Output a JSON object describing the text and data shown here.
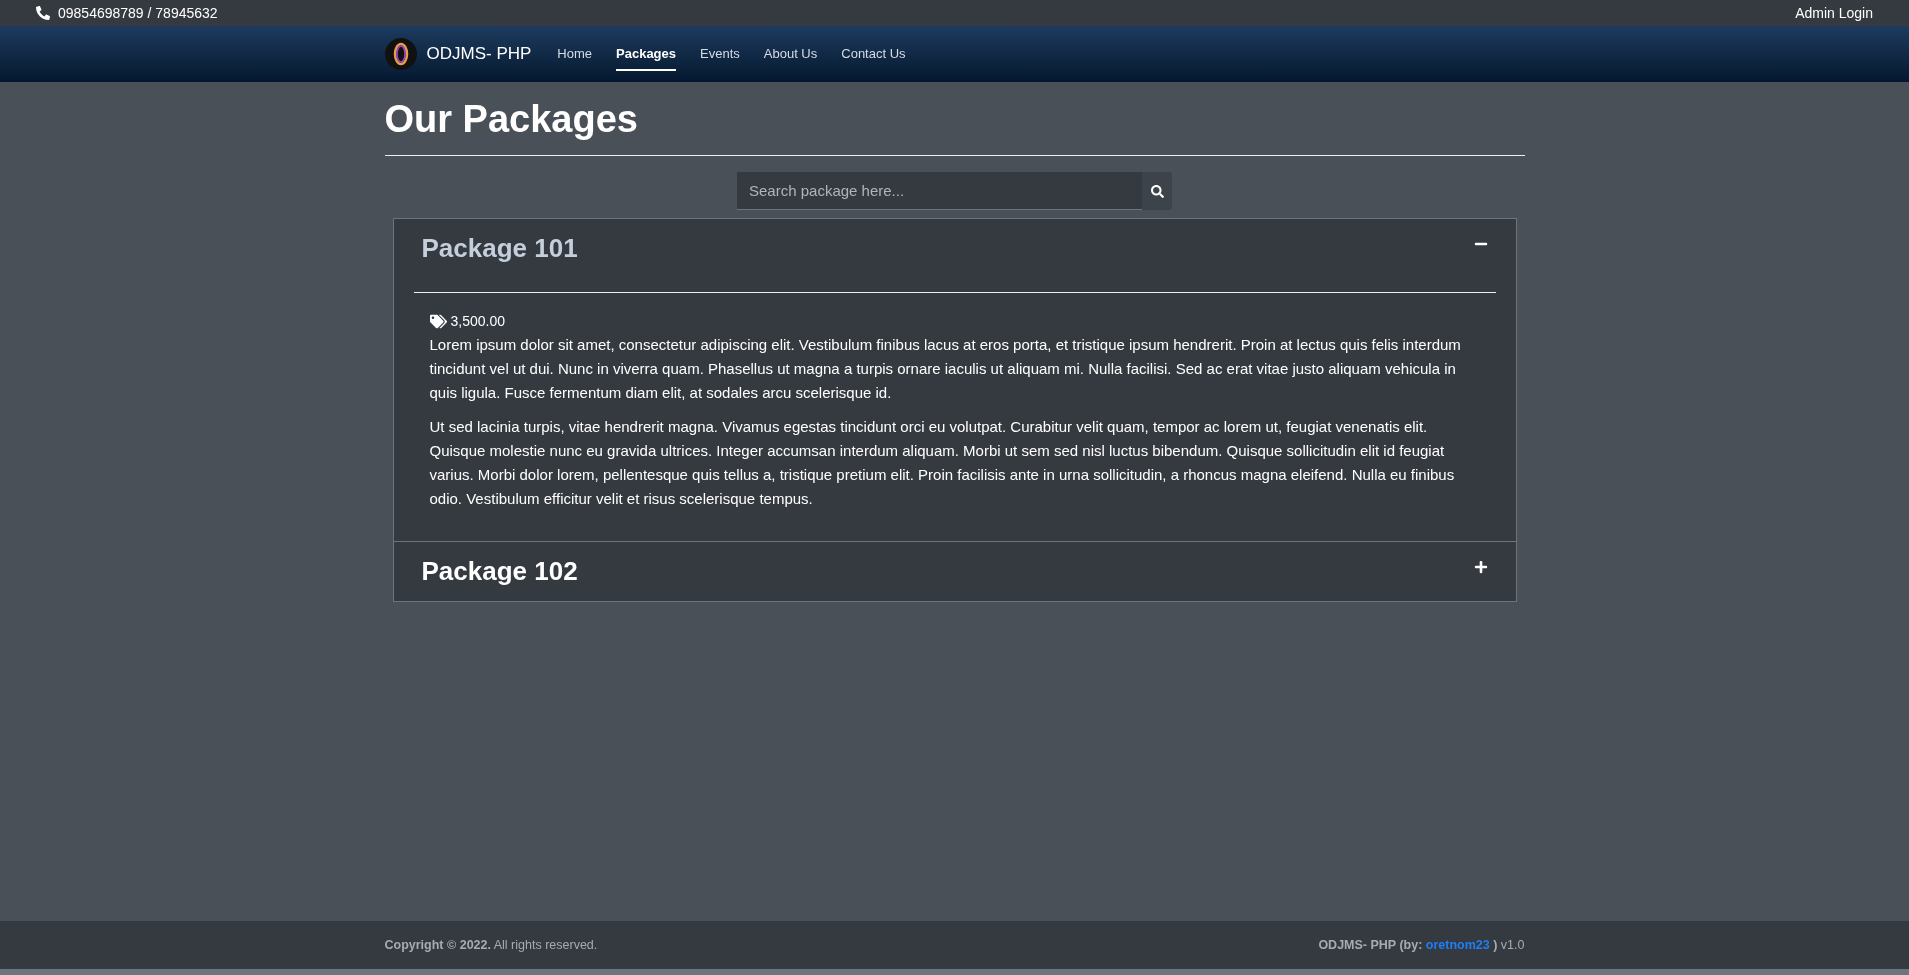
{
  "topbar": {
    "phone": "09854698789 / 78945632",
    "login": "Admin Login"
  },
  "navbar": {
    "brand": "ODJMS- PHP",
    "links": [
      {
        "label": "Home",
        "selected": false
      },
      {
        "label": "Packages",
        "selected": true
      },
      {
        "label": "Events",
        "selected": false
      },
      {
        "label": "About Us",
        "selected": false
      },
      {
        "label": "Contact Us",
        "selected": false
      }
    ]
  },
  "page_title": "Our Packages",
  "search": {
    "placeholder": "Search package here..."
  },
  "packages": [
    {
      "title": "Package 101",
      "expanded": true,
      "price": "3,500.00",
      "paragraphs": [
        "Lorem ipsum dolor sit amet, consectetur adipiscing elit. Vestibulum finibus lacus at eros porta, et tristique ipsum hendrerit. Proin at lectus quis felis interdum tincidunt vel ut dui. Nunc in viverra quam. Phasellus ut magna a turpis ornare iaculis ut aliquam mi. Nulla facilisi. Sed ac erat vitae justo aliquam vehicula in quis ligula. Fusce fermentum diam elit, at sodales arcu scelerisque id.",
        "Ut sed lacinia turpis, vitae hendrerit magna. Vivamus egestas tincidunt orci eu volutpat. Curabitur velit quam, tempor ac lorem ut, feugiat venenatis elit. Quisque molestie nunc eu gravida ultrices. Integer accumsan interdum aliquam. Morbi ut sem sed nisl luctus bibendum. Quisque sollicitudin elit id feugiat varius. Morbi dolor lorem, pellentesque quis tellus a, tristique pretium elit. Proin facilisis ante in urna sollicitudin, a rhoncus magna eleifend. Nulla eu finibus odio. Vestibulum efficitur velit et risus scelerisque tempus."
      ]
    },
    {
      "title": "Package 102",
      "expanded": false
    }
  ],
  "footer": {
    "copyright": "**Copyright © 2022.** All rights reserved.",
    "credit_prefix": "ODJMS- PHP (by:",
    "credit_link": "oretnom23",
    "credit_suffix": ")",
    "version": "v1.0"
  }
}
